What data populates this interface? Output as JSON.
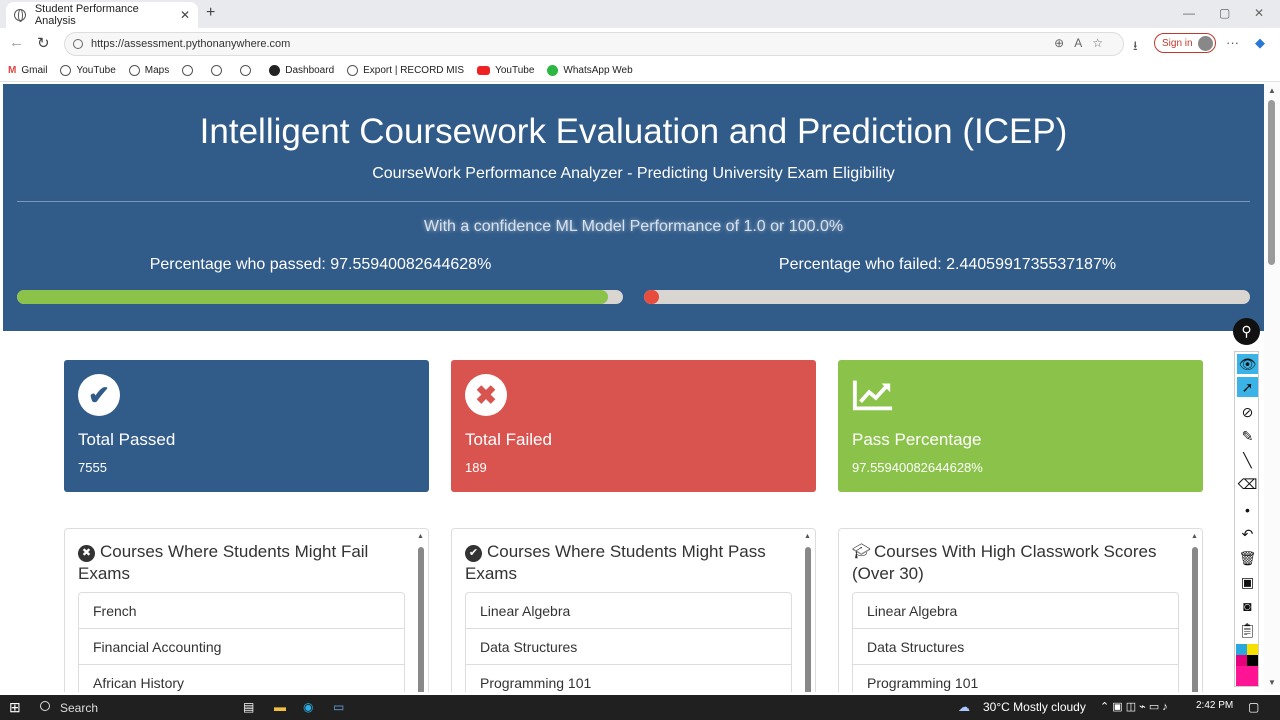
{
  "browser": {
    "tab_title": "Student Performance Analysis",
    "url": "https://assessment.pythonanywhere.com",
    "signin_label": "Sign in",
    "bookmarks": [
      "Gmail",
      "YouTube",
      "Maps",
      "",
      "",
      "",
      "Dashboard",
      "Export | RECORD MIS",
      "YouTube",
      "WhatsApp Web"
    ]
  },
  "hero": {
    "title": "Intelligent Coursework Evaluation and Prediction (ICEP)",
    "subtitle": "CourseWork Performance Analyzer - Predicting University Exam Eligibility",
    "confidence": "With a confidence ML Model Performance of 1.0 or 100.0%",
    "passed_text": "Percentage who passed: 97.55940082644628%",
    "failed_text": "Percentage who failed: 2.4405991735537187%",
    "passed_pct": 97.55940082644628,
    "failed_pct": 2.4405991735537187,
    "pass_color": "#8bc34a",
    "fail_color": "#e74c3c"
  },
  "cards": [
    {
      "label": "Total Passed",
      "value": "7555",
      "color": "#315b89",
      "icon": "check-icon"
    },
    {
      "label": "Total Failed",
      "value": "189",
      "color": "#d9534f",
      "icon": "times-icon"
    },
    {
      "label": "Pass Percentage",
      "value": "97.55940082644628%",
      "color": "#8bc34a",
      "icon": "chart-icon"
    }
  ],
  "panels": [
    {
      "title": "Courses Where Students Might Fail Exams",
      "icon": "times-circle-icon",
      "items": [
        "French",
        "Financial Accounting",
        "African History"
      ]
    },
    {
      "title": "Courses Where Students Might Pass Exams",
      "icon": "check-circle-icon",
      "items": [
        "Linear Algebra",
        "Data Structures",
        "Programming 101"
      ]
    },
    {
      "title": "Courses With High Classwork Scores (Over 30)",
      "icon": "graduation-cap-icon",
      "items": [
        "Linear Algebra",
        "Data Structures",
        "Programming 101"
      ]
    }
  ],
  "taskbar": {
    "search_label": "Search",
    "weather": "30°C  Mostly cloudy",
    "time": "2:42 PM"
  }
}
